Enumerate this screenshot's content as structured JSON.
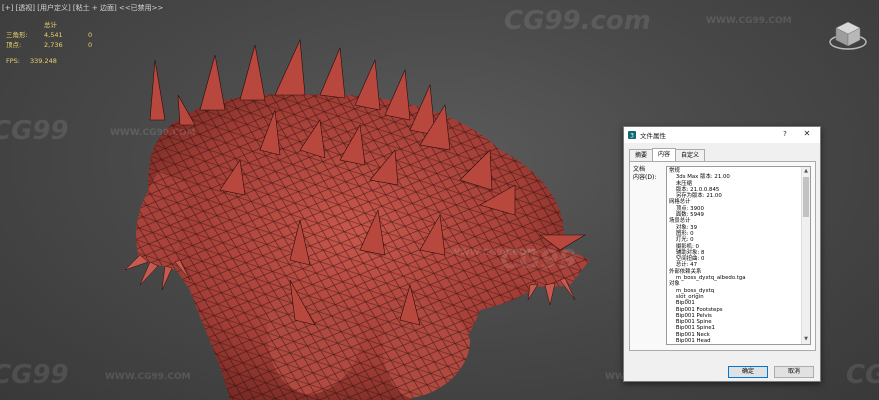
{
  "viewport": {
    "label": "[+] [透视] [用户定义] [粘土 + 边面] <<已禁用>>",
    "stats": {
      "header": "总计",
      "rows": [
        {
          "name": "三角形:",
          "value": "4,541",
          "extra": "0"
        },
        {
          "name": "顶点:",
          "value": "2,736",
          "extra": "0"
        }
      ]
    },
    "fps": {
      "label": "FPS:",
      "value": "339.248"
    },
    "watermarks": [
      "CG99.com",
      "WWW.CG99.COM",
      "CG99",
      "WWW.CG99.COM",
      "CG99",
      "WWW.CG99.COM",
      "CG99",
      "WWW.CG99.COM",
      "CG99",
      "WWW.CG99.COM"
    ],
    "viewcube_icon": "viewcube-icon"
  },
  "dialog": {
    "title": "文件属性",
    "help_label": "?",
    "close_label": "✕",
    "tabs": [
      {
        "label": "摘要",
        "active": false
      },
      {
        "label": "内容",
        "active": true
      },
      {
        "label": "自定义",
        "active": false
      }
    ],
    "field_label_1": "文档",
    "field_label_2": "内容(D):",
    "content_lines": [
      "常规",
      "    3ds Max 版本: 21.00",
      "    未压缩",
      "    版本: 21.0.0.845",
      "    另存为版本: 21.00",
      "网格总计",
      "    顶点: 3900",
      "    面数: 5949",
      "场景总计",
      "    对象: 39",
      "    图形: 0",
      "    灯光: 0",
      "    摄影机: 0",
      "    辅助对象: 8",
      "    空间扭曲: 0",
      "    总计: 47",
      "外部依赖关系",
      "    m_boss_dyxtq_albedo.tga",
      "对象",
      "    m_boss_dyxtq",
      "    slot_origin",
      "    Bip001",
      "    Bip001 Footsteps",
      "    Bip001 Pelvis",
      "    Bip001 Spine",
      "    Bip001 Spine1",
      "    Bip001 Neck",
      "    Bip001 Head"
    ],
    "ok_label": "确定",
    "cancel_label": "取消"
  },
  "colors": {
    "stats_text": "#e8d36a",
    "model_fill": "#b3463d",
    "wire": "#2a0c0a",
    "accent": "#0078d7"
  }
}
